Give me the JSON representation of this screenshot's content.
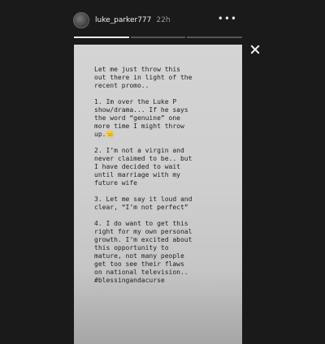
{
  "header": {
    "username": "luke_parker777",
    "time": "22h",
    "more_icon": "•••"
  },
  "story": {
    "text": "Let me just throw this\nout there in light of the\nrecent promo..\n\n1. Im over the Luke P\nshow/drama... If he says\nthe word “genuine” one\nmore time I might throw\nup.😑\n\n2. I’m not a virgin and\nnever claimed to be.. but\nI have decided to wait\nuntil marriage with my\nfuture wife\n\n3. Let me say it loud and\nclear, “I’m not perfect”\n\n4. I do want to get this\nright for my own personal\ngrowth. I’m excited about\nthis opportunity to\nmature, not many people\nget too see their flaws\non national television..\n#blessingandacurse"
  },
  "progress": {
    "segments": 3,
    "active": 0
  },
  "icons": {
    "close": "close-icon",
    "avatar": "avatar",
    "more": "more-icon"
  }
}
